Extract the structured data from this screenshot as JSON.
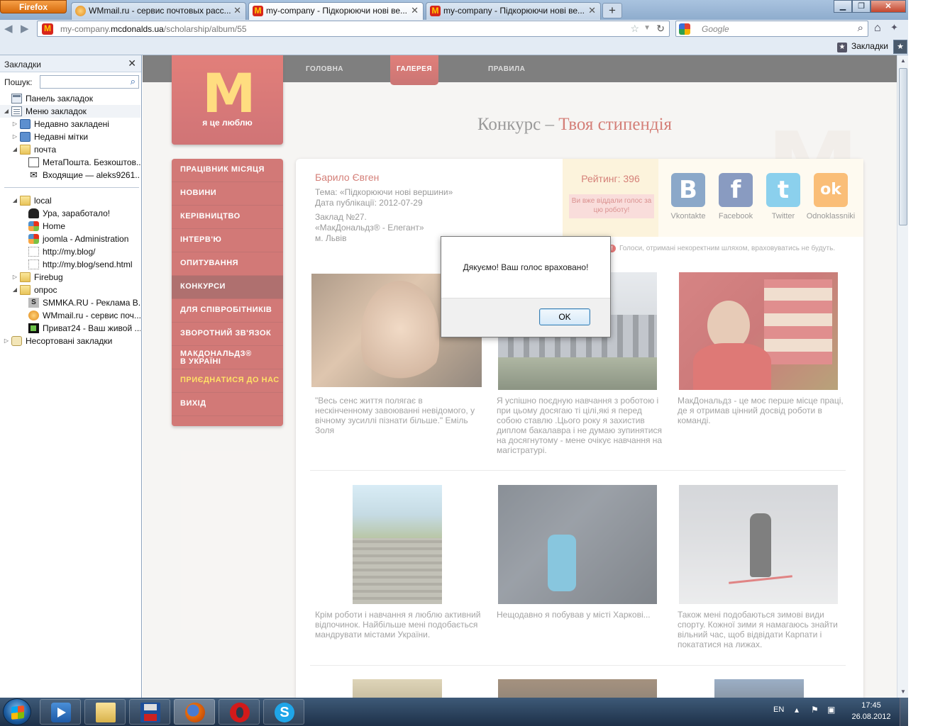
{
  "browser": {
    "app_button": "Firefox",
    "tabs": [
      {
        "label": "WMmail.ru - сервис почтовых расс...",
        "favicon": "wmmail-icon",
        "active": false
      },
      {
        "label": "my-company - Підкорюючи нові ве...",
        "favicon": "mcdonalds-icon",
        "active": true
      },
      {
        "label": "my-company - Підкорюючи нові ве...",
        "favicon": "mcdonalds-icon",
        "active": false
      }
    ],
    "url_prefix": "my-company.",
    "url_domain": "mcdonalds.ua",
    "url_path": "/scholarship/album/55",
    "search_placeholder": "Google",
    "bookmarks_toolbar_label": "Закладки"
  },
  "sidebar": {
    "title": "Закладки",
    "search_label": "Пошук:",
    "items": [
      {
        "label": "Панель закладок",
        "icon": "panel",
        "indent": 0,
        "twisty": ""
      },
      {
        "label": "Меню закладок",
        "icon": "menu",
        "indent": 0,
        "twisty": "◢"
      },
      {
        "label": "Недавно закладені",
        "icon": "smart",
        "indent": 1,
        "twisty": "▷"
      },
      {
        "label": "Недавні мітки",
        "icon": "smart",
        "indent": 1,
        "twisty": "▷"
      },
      {
        "label": "почта",
        "icon": "folder",
        "indent": 1,
        "twisty": "◢"
      },
      {
        "label": "МетаПошта. Безкоштов...",
        "icon": "meta",
        "indent": 2,
        "twisty": ""
      },
      {
        "label": "Входящие — aleks9261...",
        "icon": "mail",
        "indent": 2,
        "twisty": ""
      },
      {
        "label": "local",
        "icon": "folder",
        "indent": 1,
        "twisty": "◢"
      },
      {
        "label": "Ура, заработало!",
        "icon": "spy",
        "indent": 2,
        "twisty": ""
      },
      {
        "label": "Home",
        "icon": "joomla",
        "indent": 2,
        "twisty": ""
      },
      {
        "label": "joomla - Administration",
        "icon": "joomla",
        "indent": 2,
        "twisty": ""
      },
      {
        "label": "http://my.blog/",
        "icon": "page",
        "indent": 2,
        "twisty": ""
      },
      {
        "label": "http://my.blog/send.html",
        "icon": "page",
        "indent": 2,
        "twisty": ""
      },
      {
        "label": "Firebug",
        "icon": "folder",
        "indent": 1,
        "twisty": "▷"
      },
      {
        "label": "опрос",
        "icon": "folder",
        "indent": 1,
        "twisty": "◢"
      },
      {
        "label": "SMMKA.RU - Реклама В...",
        "icon": "smmka",
        "indent": 2,
        "twisty": ""
      },
      {
        "label": "WMmail.ru - сервис поч...",
        "icon": "wm",
        "indent": 2,
        "twisty": ""
      },
      {
        "label": "Приват24 - Ваш живой ...",
        "icon": "p24",
        "indent": 2,
        "twisty": ""
      },
      {
        "label": "Несортовані закладки",
        "icon": "unsorted",
        "indent": 0,
        "twisty": "▷"
      }
    ]
  },
  "site": {
    "logo_slogan": "я це люблю",
    "top_nav": [
      "ГОЛОВНА",
      "ГАЛЕРЕЯ",
      "ПРАВИЛА"
    ],
    "title_prefix": "Конкурс – ",
    "title_highlight": "Твоя стипендія",
    "menu": [
      {
        "label": "ПРАЦІВНИК МІСЯЦЯ"
      },
      {
        "label": "НОВИНИ"
      },
      {
        "label": "КЕРІВНИЦТВО"
      },
      {
        "label": "ІНТЕРВ'Ю"
      },
      {
        "label": "ОПИТУВАННЯ"
      },
      {
        "label": "КОНКУРСИ",
        "active": true
      },
      {
        "label": "ДЛЯ СПІВРОБІТНИКІВ"
      },
      {
        "label": "ЗВОРОТНИЙ ЗВ'ЯЗОК"
      },
      {
        "label": "МАКДОНАЛЬДЗ®\nВ УКРАЇНІ",
        "two_line": true
      },
      {
        "label": "ПРИЄДНАТИСЯ ДО НАС",
        "yellow": true
      },
      {
        "label": "ВИХІД"
      }
    ],
    "entry": {
      "author": "Барило Євген",
      "topic": "Тема: «Підкорюючи нові вершини»",
      "date": "Дата публікації: 2012-07-29",
      "place": "Заклад №27.",
      "restaurant": "«МакДональдз® - Елегант»",
      "city": "м. Львів",
      "rating": "Рейтинг: 396",
      "voted_notice": "Ви вже віддали голос за цю роботу!",
      "warning": "Голоси, отримані некоректним шляхом, враховуватись не будуть."
    },
    "social": [
      {
        "label": "Vkontakte",
        "glyph": "B",
        "color": "#3f6fa5"
      },
      {
        "label": "Facebook",
        "glyph": "f",
        "color": "#3b5998"
      },
      {
        "label": "Twitter",
        "glyph": "t",
        "color": "#3fb1e1"
      },
      {
        "label": "Odnoklassniki",
        "glyph": "ok",
        "color": "#f7931e"
      }
    ],
    "captions": [
      "\"Весь сенс життя полягає в нескінченному завоюванні невідомого, у вічному зусиллі пізнати більше.\" Еміль Золя",
      "Я успішно поєдную навчання з роботою і при цьому досягаю ті цілі,які я перед собою ставлю .Цього року я захистив диплом бакалавра і не думаю зупинятися на досягнутому - мене очікує навчання на магістратурі.",
      "МакДональдз - це моє перше місце праці, де я отримав цінний досвід роботи в команді.",
      "Крім роботи і навчання я люблю активний відпочинок. Найбільше мені подобається мандрувати містами України.",
      "Нещодавно я побував у місті Харкові...",
      "Також мені подобаються зимові види спорту. Кожної зими я намагаюсь знайти вільний час, щоб відвідати Карпати і покататися на лижах."
    ]
  },
  "dialog": {
    "message": "Дякуємо! Ваш голос враховано!",
    "ok_label": "OK"
  },
  "taskbar": {
    "apps": [
      "media-player-icon",
      "explorer-icon",
      "floppy-icon",
      "firefox-icon",
      "opera-icon",
      "skype-icon"
    ],
    "lang": "EN",
    "time": "17:45",
    "date": "26.08.2012"
  }
}
